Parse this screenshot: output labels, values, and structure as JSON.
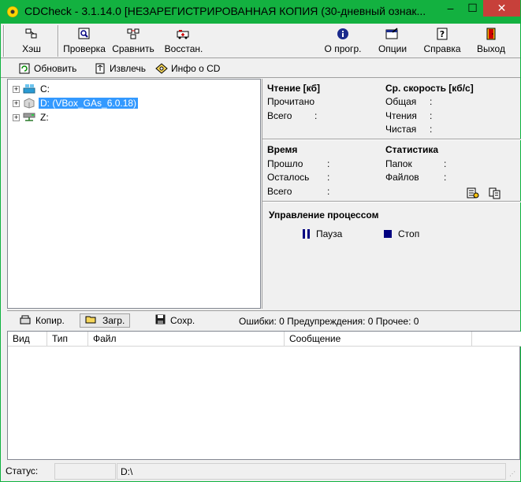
{
  "window": {
    "title": "CDCheck - 3.1.14.0 [НЕЗАРЕГИСТРИРОВАННАЯ КОПИЯ (30-дневный ознак...",
    "controls": {
      "minimize": "–",
      "maximize": "☐",
      "close": "✕"
    }
  },
  "toolbar": {
    "hash": "Хэш",
    "verify": "Проверка",
    "compare": "Сравнить",
    "restore": "Восстан.",
    "about": "О прогр.",
    "options": "Опции",
    "help": "Справка",
    "exit": "Выход"
  },
  "toolbar2": {
    "refresh": "Обновить",
    "eject": "Извлечь",
    "cdinfo": "Инфо о CD"
  },
  "tree": {
    "items": [
      {
        "label": "C:",
        "icon": "hard-drive-icon",
        "selected": false
      },
      {
        "label": "D: (VBox_GAs_6.0.18)",
        "icon": "cd-drive-icon",
        "selected": true
      },
      {
        "label": "Z:",
        "icon": "network-drive-icon",
        "selected": false
      }
    ]
  },
  "info": {
    "read_header": "Чтение [кб]",
    "read_done": "Прочитано",
    "read_total": "Всего",
    "speed_header": "Ср. скорость [кб/с]",
    "speed_overall": "Общая",
    "speed_read": "Чтения",
    "speed_net": "Чистая",
    "time_header": "Время",
    "time_elapsed": "Прошло",
    "time_left": "Осталось",
    "time_total": "Всего",
    "stats_header": "Статистика",
    "stats_folders": "Папок",
    "stats_files": "Файлов",
    "colon": ":",
    "process_header": "Управление процессом",
    "pause": "Пауза",
    "stop": "Стоп"
  },
  "bottom_toolbar": {
    "copy": "Копир.",
    "load": "Загр.",
    "save": "Сохр.",
    "counts": "Ошибки: 0  Предупреждения: 0  Прочее: 0"
  },
  "list": {
    "columns": [
      "Вид",
      "Тип",
      "Файл",
      "Сообщение"
    ]
  },
  "status": {
    "label": "Статус:",
    "path": "D:\\"
  }
}
